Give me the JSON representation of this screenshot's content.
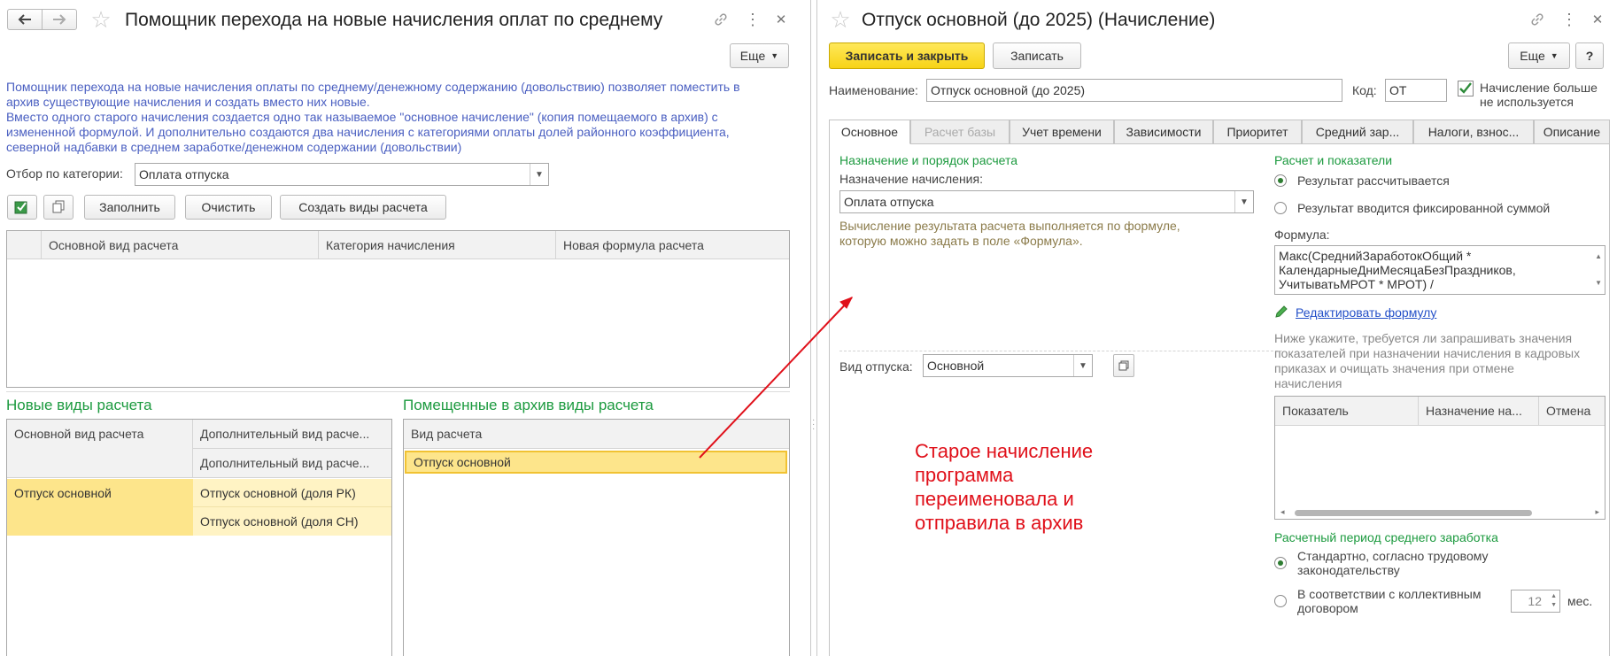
{
  "left": {
    "title": "Помощник перехода на новые начисления оплат по среднему",
    "more_label": "Еще",
    "intro": [
      "Помощник перехода на новые начисления оплаты по среднему/денежному содержанию (довольствию) позволяет поместить в",
      "архив существующие начисления и создать вместо них новые.",
      "Вместо одного старого начисления создается одно так называемое \"основное начисление\" (копия помещаемого в архив) с",
      "измененной формулой. И дополнительно создаются два начисления с категориями оплаты долей районного коэффициента,",
      "северной надбавки в среднем заработке/денежном содержании (довольствии)"
    ],
    "filter_label": "Отбор по категории:",
    "filter_value": "Оплата отпуска",
    "buttons": {
      "fill": "Заполнить",
      "clear": "Очистить",
      "create": "Создать виды расчета"
    },
    "top_table_headers": [
      "Основной вид расчета",
      "Категория начисления",
      "Новая формула расчета"
    ],
    "new_types_title": "Новые виды расчета",
    "new_types_headers": [
      "Основной вид расчета",
      "Дополнительный вид расче...",
      "Дополнительный вид расче..."
    ],
    "new_types_row": {
      "main": "Отпуск основной",
      "add1": "Отпуск основной (доля РК)",
      "add2": "Отпуск основной (доля СН)"
    },
    "archive_title": "Помещенные в архив виды расчета",
    "archive_header": "Вид расчета",
    "archive_row": "Отпуск основной"
  },
  "right": {
    "title": "Отпуск основной (до 2025) (Начисление)",
    "save_close_label": "Записать и закрыть",
    "save_label": "Записать",
    "more_label": "Еще",
    "help_label": "?",
    "name_label": "Наименование:",
    "name_value": "Отпуск основной (до 2025)",
    "code_label": "Код:",
    "code_value": "ОТ",
    "not_used_line1": "Начисление больше",
    "not_used_line2": "не используется",
    "tabs": [
      "Основное",
      "Расчет базы",
      "Учет времени",
      "Зависимости",
      "Приоритет",
      "Средний зар...",
      "Налоги, взнос...",
      "Описание"
    ],
    "purpose_section": "Назначение и порядок расчета",
    "purpose_label": "Назначение начисления:",
    "purpose_value": "Оплата отпуска",
    "calc_hint_1": "Вычисление результата расчета выполняется по формуле,",
    "calc_hint_2": "которую можно задать в поле «Формула».",
    "vacation_label": "Вид отпуска:",
    "vacation_value": "Основной",
    "calc_section": "Расчет и показатели",
    "radio_calc": "Результат рассчитывается",
    "radio_fixed": "Результат вводится фиксированной суммой",
    "formula_label": "Формула:",
    "formula_lines": [
      "Макс(СреднийЗаработокОбщий *",
      "КалендарныеДниМесяцаБезПраздников,",
      "УчитыватьМРОТ * МРОТ) /"
    ],
    "edit_formula": "Редактировать формулу",
    "indicators_hint": [
      "Ниже укажите, требуется ли запрашивать значения",
      "показателей при назначении начисления в кадровых",
      "приказах и очищать значения при отмене",
      "начисления"
    ],
    "ind_headers": [
      "Показатель",
      "Назначение на...",
      "Отмена"
    ],
    "period_section": "Расчетный период среднего заработка",
    "period_std_1": "Стандартно, согласно трудовому",
    "period_std_2": "законодательству",
    "period_coll_1": "В соответствии с коллективным",
    "period_coll_2": "договором",
    "months_value": "12",
    "months_unit": "мес."
  },
  "annotation": [
    "Старое начисление",
    "программа",
    "переименовала и",
    "отправила в архив"
  ],
  "colors": {
    "annotation": "#e0101a",
    "section_green": "#1c9a3f",
    "intro_blue": "#4a5fc1",
    "highlight": "#fde58b",
    "highlight_light": "#fff3c4"
  }
}
